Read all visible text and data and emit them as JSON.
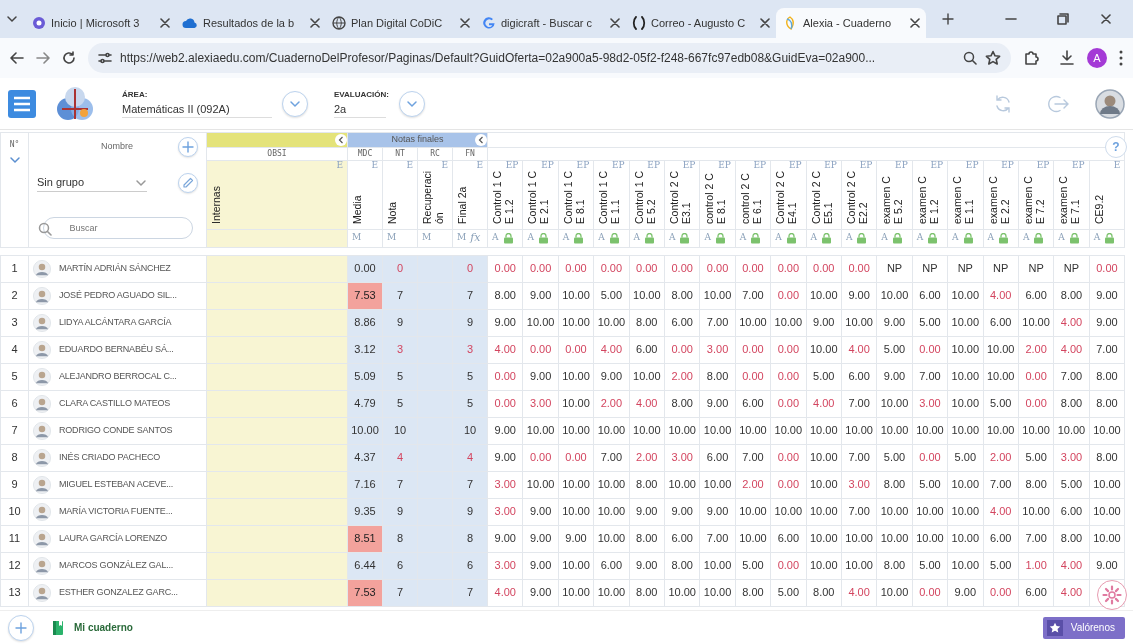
{
  "browser": {
    "tabs": [
      {
        "title": "Inicio | Microsoft 3",
        "selected": false
      },
      {
        "title": "Resultados de la b",
        "selected": false
      },
      {
        "title": "Plan Digital CoDiC",
        "selected": false
      },
      {
        "title": "digicraft - Buscar c",
        "selected": false
      },
      {
        "title": "Correo - Augusto C",
        "selected": false
      },
      {
        "title": "Alexia - Cuaderno",
        "selected": true
      }
    ],
    "url": "https://web2.alexiaedu.com/CuadernoDelProfesor/Paginas/Default?GuidOferta=02a900a5-98d2-05f2-f248-667fc97edb08&GuidEva=02a900...",
    "profile_initial": "A"
  },
  "app": {
    "area_label": "ÁREA:",
    "area_value": "Matemáticas II (092A)",
    "evaluation_label": "EVALUACIÓN:",
    "evaluation_value": "2a"
  },
  "grid": {
    "number_header": "N°",
    "name_header": "Nombre",
    "group_select": "Sin grupo",
    "search_placeholder": "Buscar",
    "groups": [
      {
        "kind": "obs",
        "codes": [
          "OBSI"
        ]
      },
      {
        "kind": "final",
        "title": "Notas finales",
        "codes": [
          "MDC",
          "NT",
          "RC",
          "FN"
        ]
      }
    ],
    "columns": [
      {
        "kind": "obs",
        "title": "Internas",
        "tag": "E"
      },
      {
        "kind": "final",
        "title": "Media",
        "tag": "E",
        "foot": "M"
      },
      {
        "kind": "final",
        "title": "Nota",
        "tag": "E",
        "foot": "M"
      },
      {
        "kind": "final",
        "title": "Recuperación",
        "tag": "E",
        "foot": "M"
      },
      {
        "kind": "final",
        "title": "Final 2a",
        "tag": "E",
        "foot": "M",
        "formula": "fx"
      },
      {
        "kind": "grade",
        "title": "Control 1 CE 1.2",
        "tag": "EP",
        "foot": "A"
      },
      {
        "kind": "grade",
        "title": "Control 1 CE 2.1",
        "tag": "EP",
        "foot": "A"
      },
      {
        "kind": "grade",
        "title": "Control 1 CE 8.1",
        "tag": "EP",
        "foot": "A"
      },
      {
        "kind": "grade",
        "title": "Control 1 CE 1.1",
        "tag": "EP",
        "foot": "A"
      },
      {
        "kind": "grade",
        "title": "Control 1 CE 5.2",
        "tag": "EP",
        "foot": "A"
      },
      {
        "kind": "grade",
        "title": "Control 2 CE3.1",
        "tag": "EP",
        "foot": "A"
      },
      {
        "kind": "grade",
        "title": "control 2 CE 8.1",
        "tag": "EP",
        "foot": "A"
      },
      {
        "kind": "grade",
        "title": "control 2 CE 6.1",
        "tag": "EP",
        "foot": "A"
      },
      {
        "kind": "grade",
        "title": "Control 2 CE4.1",
        "tag": "EP",
        "foot": "A"
      },
      {
        "kind": "grade",
        "title": "Control 2 CE5.1",
        "tag": "EP",
        "foot": "A"
      },
      {
        "kind": "grade",
        "title": "Control 2 CE2.2",
        "tag": "EP",
        "foot": "A"
      },
      {
        "kind": "grade",
        "title": "examen CE 5.2",
        "tag": "EP",
        "foot": "A"
      },
      {
        "kind": "grade",
        "title": "examen CE 1.2",
        "tag": "EP",
        "foot": "A"
      },
      {
        "kind": "grade",
        "title": "examen CE 1.1",
        "tag": "EP",
        "foot": "A"
      },
      {
        "kind": "grade",
        "title": "examen CE 2.2",
        "tag": "EP",
        "foot": "A"
      },
      {
        "kind": "grade",
        "title": "examen CE 7.2",
        "tag": "EP",
        "foot": "A"
      },
      {
        "kind": "grade",
        "title": "examen CE 7.1",
        "tag": "EP",
        "foot": "A"
      },
      {
        "kind": "grade",
        "title": "CE9.2",
        "tag": "E",
        "foot": "A"
      }
    ],
    "rows": [
      {
        "number": "1",
        "name": "MARTÍN ADRIÁN SÁNCHEZ",
        "media": "0.00",
        "flagged": false,
        "nota": "0",
        "final": "0",
        "low": true,
        "scores": [
          "0.00",
          "0.00",
          "0.00",
          "0.00",
          "0.00",
          "0.00",
          "0.00",
          "0.00",
          "0.00",
          "0.00",
          "0.00",
          "NP",
          "NP",
          "NP",
          "NP",
          "NP",
          "NP",
          "0.00"
        ],
        "low_scores": [
          true,
          true,
          true,
          true,
          true,
          true,
          true,
          true,
          true,
          true,
          true,
          false,
          false,
          false,
          false,
          false,
          false,
          true
        ]
      },
      {
        "number": "2",
        "name": "JOSÉ PEDRO AGUADO SIL...",
        "media": "7.53",
        "flagged": true,
        "nota": "7",
        "final": "7",
        "low": false,
        "scores": [
          "8.00",
          "9.00",
          "10.00",
          "5.00",
          "10.00",
          "8.00",
          "10.00",
          "7.00",
          "0.00",
          "10.00",
          "9.00",
          "10.00",
          "6.00",
          "10.00",
          "4.00",
          "6.00",
          "8.00",
          "9.00"
        ],
        "low_scores": [
          false,
          false,
          false,
          false,
          false,
          false,
          false,
          false,
          true,
          false,
          false,
          false,
          false,
          false,
          true,
          false,
          false,
          false
        ]
      },
      {
        "number": "3",
        "name": "LIDYA ALCÁNTARA GARCÍA",
        "media": "8.86",
        "flagged": false,
        "nota": "9",
        "final": "9",
        "low": false,
        "scores": [
          "9.00",
          "10.00",
          "10.00",
          "10.00",
          "8.00",
          "6.00",
          "7.00",
          "10.00",
          "10.00",
          "9.00",
          "10.00",
          "9.00",
          "5.00",
          "10.00",
          "6.00",
          "10.00",
          "4.00",
          "9.00"
        ],
        "low_scores": [
          false,
          false,
          false,
          false,
          false,
          false,
          false,
          false,
          false,
          false,
          false,
          false,
          false,
          false,
          false,
          false,
          true,
          false
        ]
      },
      {
        "number": "4",
        "name": "EDUARDO BERNABÉU SÁ...",
        "media": "3.12",
        "flagged": false,
        "nota": "3",
        "final": "3",
        "low": true,
        "scores": [
          "4.00",
          "0.00",
          "0.00",
          "4.00",
          "6.00",
          "0.00",
          "3.00",
          "0.00",
          "0.00",
          "10.00",
          "4.00",
          "5.00",
          "0.00",
          "10.00",
          "10.00",
          "2.00",
          "4.00",
          "7.00"
        ],
        "low_scores": [
          true,
          true,
          true,
          true,
          false,
          true,
          true,
          true,
          true,
          false,
          true,
          false,
          true,
          false,
          false,
          true,
          true,
          false
        ]
      },
      {
        "number": "5",
        "name": "ALEJANDRO BERROCAL C...",
        "media": "5.09",
        "flagged": false,
        "nota": "5",
        "final": "5",
        "low": false,
        "scores": [
          "0.00",
          "9.00",
          "10.00",
          "9.00",
          "10.00",
          "2.00",
          "8.00",
          "0.00",
          "0.00",
          "5.00",
          "6.00",
          "9.00",
          "7.00",
          "10.00",
          "10.00",
          "0.00",
          "7.00",
          "8.00"
        ],
        "low_scores": [
          true,
          false,
          false,
          false,
          false,
          true,
          false,
          true,
          true,
          false,
          false,
          false,
          false,
          false,
          false,
          true,
          false,
          false
        ]
      },
      {
        "number": "6",
        "name": "CLARA CASTILLO MATEOS",
        "media": "4.79",
        "flagged": false,
        "nota": "5",
        "final": "5",
        "low": false,
        "scores": [
          "0.00",
          "3.00",
          "10.00",
          "2.00",
          "4.00",
          "8.00",
          "9.00",
          "6.00",
          "0.00",
          "4.00",
          "7.00",
          "10.00",
          "3.00",
          "10.00",
          "5.00",
          "0.00",
          "8.00",
          "8.00"
        ],
        "low_scores": [
          true,
          true,
          false,
          true,
          true,
          false,
          false,
          false,
          true,
          true,
          false,
          false,
          true,
          false,
          false,
          true,
          false,
          false
        ]
      },
      {
        "number": "7",
        "name": "RODRIGO CONDE SANTOS",
        "media": "10.00",
        "flagged": false,
        "nota": "10",
        "final": "10",
        "low": false,
        "scores": [
          "9.00",
          "10.00",
          "10.00",
          "10.00",
          "10.00",
          "10.00",
          "10.00",
          "10.00",
          "10.00",
          "10.00",
          "10.00",
          "10.00",
          "10.00",
          "10.00",
          "10.00",
          "10.00",
          "10.00",
          "10.00"
        ],
        "low_scores": [
          false,
          false,
          false,
          false,
          false,
          false,
          false,
          false,
          false,
          false,
          false,
          false,
          false,
          false,
          false,
          false,
          false,
          false
        ]
      },
      {
        "number": "8",
        "name": "INÉS CRIADO PACHECO",
        "media": "4.37",
        "flagged": false,
        "nota": "4",
        "final": "4",
        "low": true,
        "scores": [
          "9.00",
          "0.00",
          "0.00",
          "7.00",
          "2.00",
          "3.00",
          "6.00",
          "7.00",
          "0.00",
          "10.00",
          "7.00",
          "5.00",
          "0.00",
          "5.00",
          "2.00",
          "5.00",
          "3.00",
          "8.00"
        ],
        "low_scores": [
          false,
          true,
          true,
          false,
          true,
          true,
          false,
          false,
          true,
          false,
          false,
          false,
          true,
          false,
          true,
          false,
          true,
          false
        ]
      },
      {
        "number": "9",
        "name": "MIGUEL ESTEBAN ACEVE...",
        "media": "7.16",
        "flagged": false,
        "nota": "7",
        "final": "7",
        "low": false,
        "scores": [
          "3.00",
          "10.00",
          "10.00",
          "10.00",
          "8.00",
          "10.00",
          "10.00",
          "2.00",
          "0.00",
          "10.00",
          "3.00",
          "8.00",
          "5.00",
          "10.00",
          "7.00",
          "8.00",
          "5.00",
          "10.00"
        ],
        "low_scores": [
          true,
          false,
          false,
          false,
          false,
          false,
          false,
          true,
          true,
          false,
          true,
          false,
          false,
          false,
          false,
          false,
          false,
          false
        ]
      },
      {
        "number": "10",
        "name": "MARÍA VICTORIA FUENTE...",
        "media": "9.35",
        "flagged": false,
        "nota": "9",
        "final": "9",
        "low": false,
        "scores": [
          "3.00",
          "9.00",
          "10.00",
          "10.00",
          "9.00",
          "9.00",
          "9.00",
          "10.00",
          "10.00",
          "10.00",
          "7.00",
          "10.00",
          "10.00",
          "10.00",
          "4.00",
          "10.00",
          "6.00",
          "10.00"
        ],
        "low_scores": [
          true,
          false,
          false,
          false,
          false,
          false,
          false,
          false,
          false,
          false,
          false,
          false,
          false,
          false,
          true,
          false,
          false,
          false
        ]
      },
      {
        "number": "11",
        "name": "LAURA GARCÍA LORENZO",
        "media": "8.51",
        "flagged": true,
        "nota": "8",
        "final": "8",
        "low": false,
        "scores": [
          "9.00",
          "9.00",
          "9.00",
          "10.00",
          "8.00",
          "6.00",
          "7.00",
          "10.00",
          "6.00",
          "10.00",
          "10.00",
          "10.00",
          "10.00",
          "10.00",
          "6.00",
          "7.00",
          "8.00",
          "10.00"
        ],
        "low_scores": [
          false,
          false,
          false,
          false,
          false,
          false,
          false,
          false,
          false,
          false,
          false,
          false,
          false,
          false,
          false,
          false,
          false,
          false
        ]
      },
      {
        "number": "12",
        "name": "MARCOS GONZÁLEZ GAL...",
        "media": "6.44",
        "flagged": false,
        "nota": "6",
        "final": "6",
        "low": false,
        "scores": [
          "3.00",
          "9.00",
          "10.00",
          "6.00",
          "9.00",
          "8.00",
          "10.00",
          "5.00",
          "0.00",
          "10.00",
          "10.00",
          "8.00",
          "5.00",
          "10.00",
          "5.00",
          "1.00",
          "4.00",
          "9.00"
        ],
        "low_scores": [
          true,
          false,
          false,
          false,
          false,
          false,
          false,
          false,
          true,
          false,
          false,
          false,
          false,
          false,
          false,
          true,
          true,
          false
        ]
      },
      {
        "number": "13",
        "name": "ESTHER GONZALEZ GARC...",
        "media": "7.53",
        "flagged": true,
        "nota": "7",
        "final": "7",
        "low": false,
        "scores": [
          "4.00",
          "9.00",
          "10.00",
          "10.00",
          "8.00",
          "10.00",
          "10.00",
          "8.00",
          "5.00",
          "8.00",
          "4.00",
          "10.00",
          "0.00",
          "9.00",
          "0.00",
          "6.00",
          "4.00"
        ],
        "low_scores": [
          true,
          false,
          false,
          false,
          false,
          false,
          false,
          false,
          false,
          false,
          true,
          false,
          true,
          false,
          true,
          false,
          true
        ]
      }
    ]
  },
  "footer": {
    "help": "?",
    "notebook": "Mi cuaderno",
    "rate": "Valórenos"
  }
}
